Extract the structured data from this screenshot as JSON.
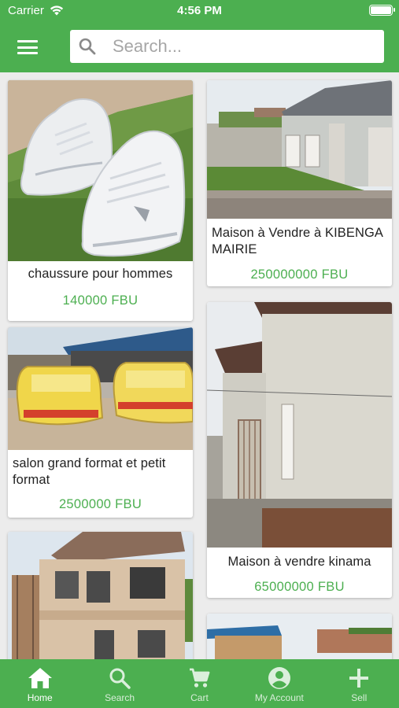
{
  "status_bar": {
    "carrier": "Carrier",
    "time": "4:56 PM"
  },
  "search": {
    "placeholder": "Search..."
  },
  "listings": [
    {
      "title": "chaussure pour hommes",
      "price": "140000 FBU"
    },
    {
      "title": "Maison à Vendre à KIBENGA MAIRIE",
      "price": "250000000 FBU"
    },
    {
      "title": "salon grand format et petit format",
      "price": "2500000 FBU"
    },
    {
      "title": "Maison à vendre kinama",
      "price": "65000000 FBU"
    }
  ],
  "tabs": [
    {
      "label": "Home",
      "icon": "home-icon",
      "active": true
    },
    {
      "label": "Search",
      "icon": "search-icon",
      "active": false
    },
    {
      "label": "Cart",
      "icon": "cart-icon",
      "active": false
    },
    {
      "label": "My Account",
      "icon": "account-icon",
      "active": false
    },
    {
      "label": "Sell",
      "icon": "plus-icon",
      "active": false
    }
  ],
  "colors": {
    "primary": "#4caf50",
    "price": "#4caf50",
    "background": "#ececec"
  }
}
